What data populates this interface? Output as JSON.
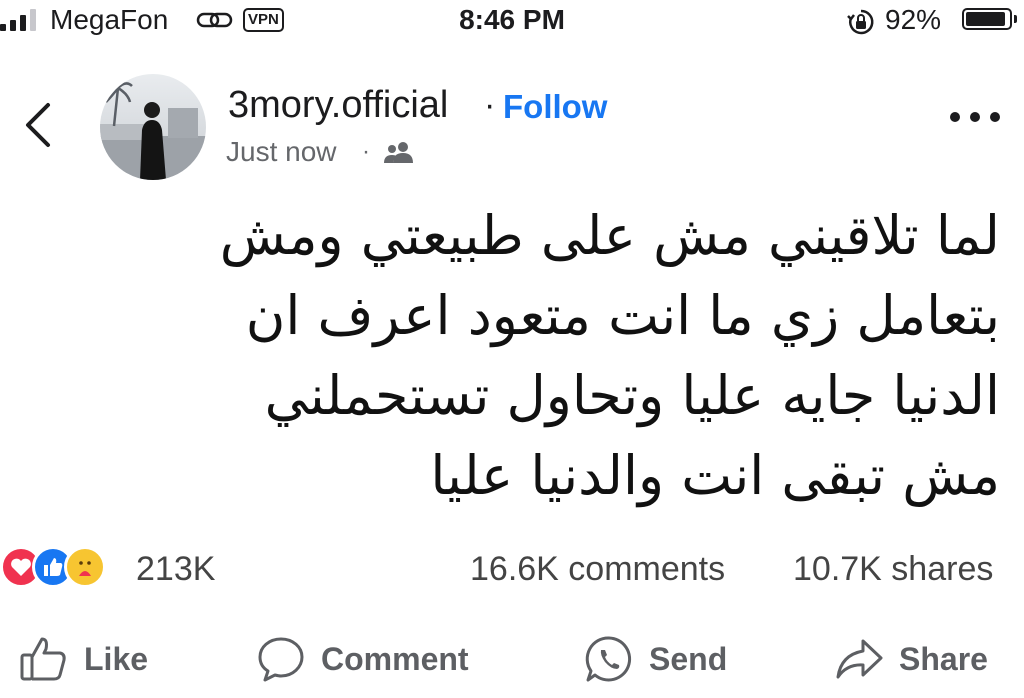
{
  "status_bar": {
    "carrier": "MegaFon",
    "vpn_label": "VPN",
    "time": "8:46 PM",
    "battery_percent": "92%",
    "battery_level": 0.92,
    "icons": [
      "signal-icon",
      "link-icon",
      "orientation-lock-icon",
      "battery-icon"
    ]
  },
  "post": {
    "author": "3mory.official",
    "separator": "·",
    "follow_label": "Follow",
    "timestamp": "Just now",
    "timestamp_separator": "·",
    "audience_icon": "friends-icon",
    "text_lines": [
      "لما تلاقيني مش على طبيعتي ومش",
      "بتعامل زي ما انت متعود اعرف ان",
      "الدنيا جايه عليا وتحاول تستحملني",
      "مش تبقى انت والدنيا عليا"
    ]
  },
  "stats": {
    "reaction_icons": [
      "love-icon",
      "like-icon",
      "care-icon"
    ],
    "reactions_count": "213K",
    "comments": "16.6K comments",
    "shares": "10.7K shares"
  },
  "actions": {
    "like": "Like",
    "comment": "Comment",
    "send": "Send",
    "share": "Share"
  },
  "colors": {
    "accent": "#1877f2",
    "text": "#1c1c1e",
    "secondary_text": "#65676b",
    "love": "#f0324f",
    "care": "#f7c531"
  }
}
